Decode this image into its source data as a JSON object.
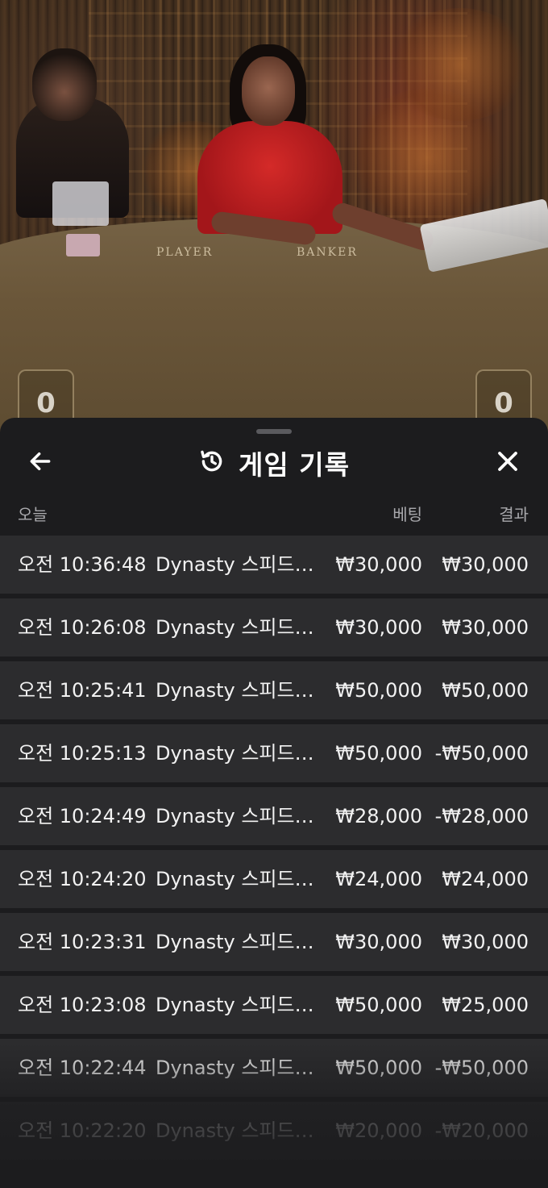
{
  "video": {
    "table_labels": [
      "PLAYER",
      "BANKER"
    ],
    "scores": [
      "0",
      "0"
    ]
  },
  "sheet": {
    "title": "게임 기록",
    "icons": {
      "back": "arrow-left-icon",
      "history": "history-icon",
      "close": "close-icon"
    },
    "columns": {
      "date": "오늘",
      "bet": "베팅",
      "result": "결과"
    },
    "rows": [
      {
        "time": "오전 10:36:48",
        "game": "Dynasty 스피드 ...",
        "bet": "₩30,000",
        "result": "₩30,000"
      },
      {
        "time": "오전 10:26:08",
        "game": "Dynasty 스피드 ...",
        "bet": "₩30,000",
        "result": "₩30,000"
      },
      {
        "time": "오전 10:25:41",
        "game": "Dynasty 스피드 ...",
        "bet": "₩50,000",
        "result": "₩50,000"
      },
      {
        "time": "오전 10:25:13",
        "game": "Dynasty 스피드 ...",
        "bet": "₩50,000",
        "result": "-₩50,000"
      },
      {
        "time": "오전 10:24:49",
        "game": "Dynasty 스피드 ...",
        "bet": "₩28,000",
        "result": "-₩28,000"
      },
      {
        "time": "오전 10:24:20",
        "game": "Dynasty 스피드 ...",
        "bet": "₩24,000",
        "result": "₩24,000"
      },
      {
        "time": "오전 10:23:31",
        "game": "Dynasty 스피드 ...",
        "bet": "₩30,000",
        "result": "₩30,000"
      },
      {
        "time": "오전 10:23:08",
        "game": "Dynasty 스피드 ...",
        "bet": "₩50,000",
        "result": "₩25,000"
      },
      {
        "time": "오전 10:22:44",
        "game": "Dynasty 스피드 ...",
        "bet": "₩50,000",
        "result": "-₩50,000"
      },
      {
        "time": "오전 10:22:20",
        "game": "Dynasty 스피드 ...",
        "bet": "₩20,000",
        "result": "-₩20,000"
      }
    ]
  },
  "colors": {
    "sheet_bg": "#1c1c1e",
    "row_bg": "#2c2c2e",
    "text": "#f2f2f2",
    "muted": "#a9a9ad"
  }
}
